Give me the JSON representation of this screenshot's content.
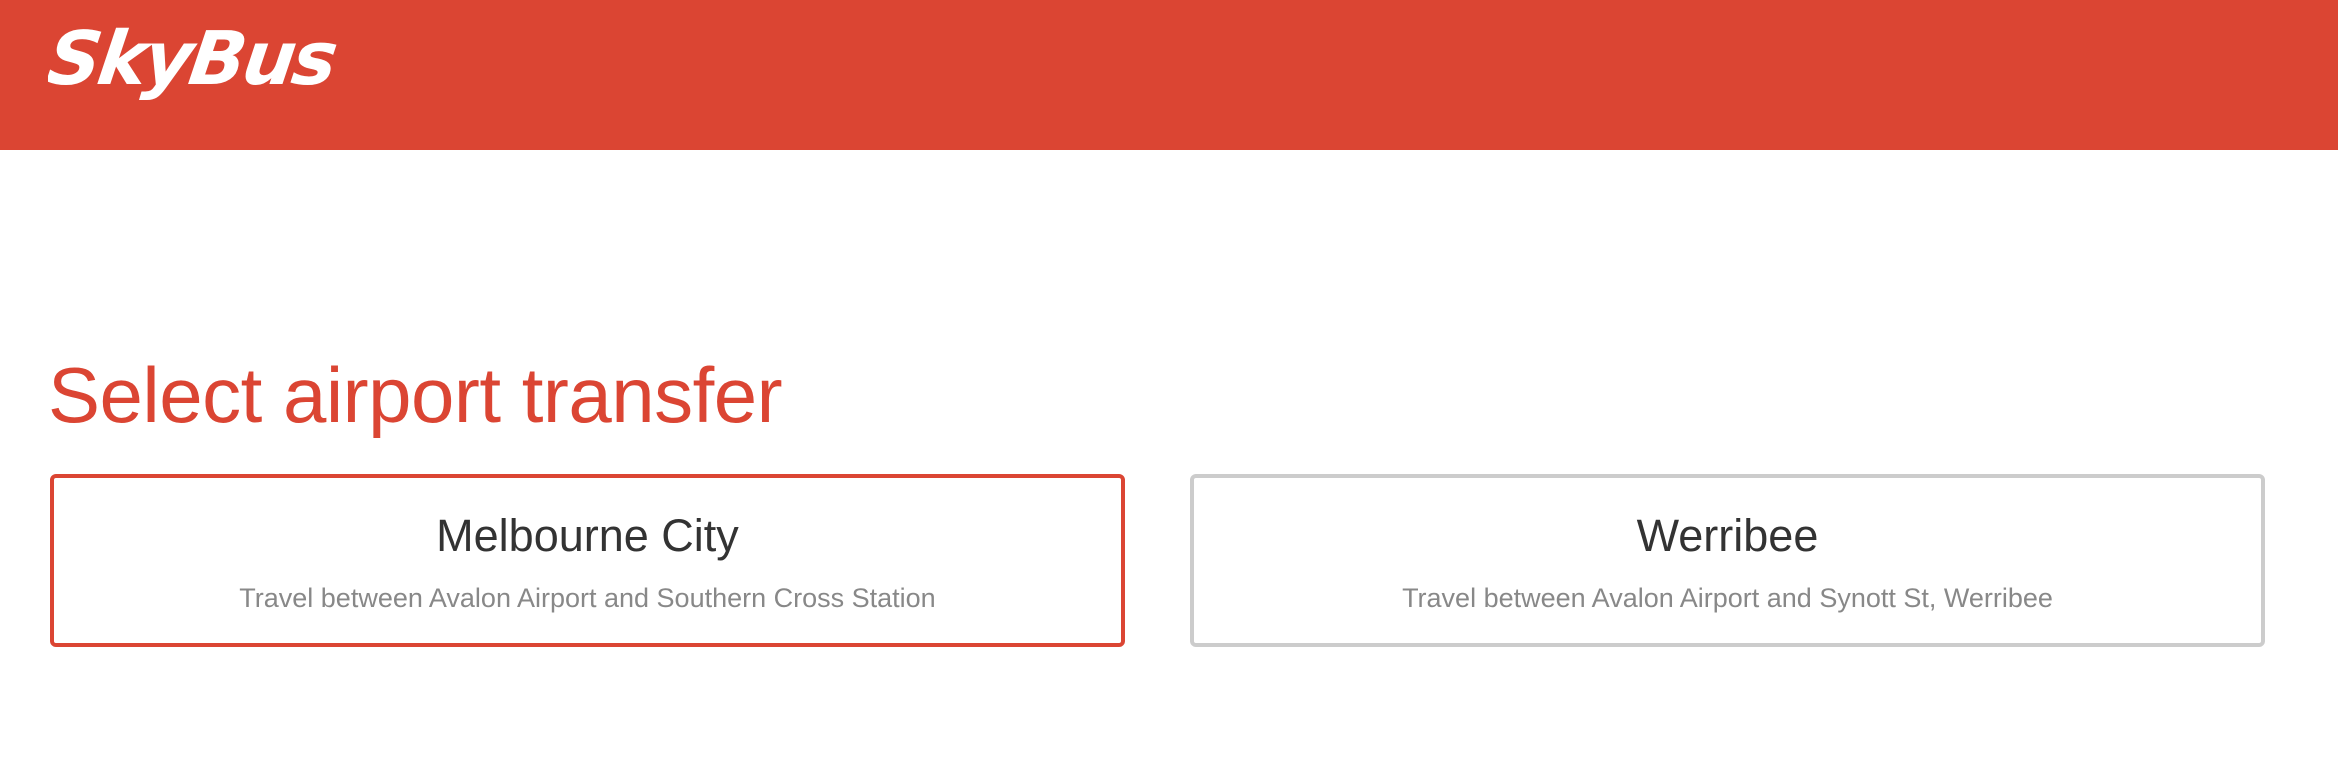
{
  "header": {
    "brand_color": "#db4533",
    "logo_text": "SkyBus"
  },
  "page": {
    "title": "Select airport transfer"
  },
  "routes": [
    {
      "name": "Melbourne City",
      "description": "Travel between Avalon Airport and Southern Cross Station",
      "selected": true
    },
    {
      "name": "Werribee",
      "description": "Travel between Avalon Airport and Synott St, Werribee",
      "selected": false
    }
  ],
  "colors": {
    "accent": "#db4533",
    "card_border": "#cccccc",
    "route_name": "#333333",
    "route_desc": "#888888"
  }
}
